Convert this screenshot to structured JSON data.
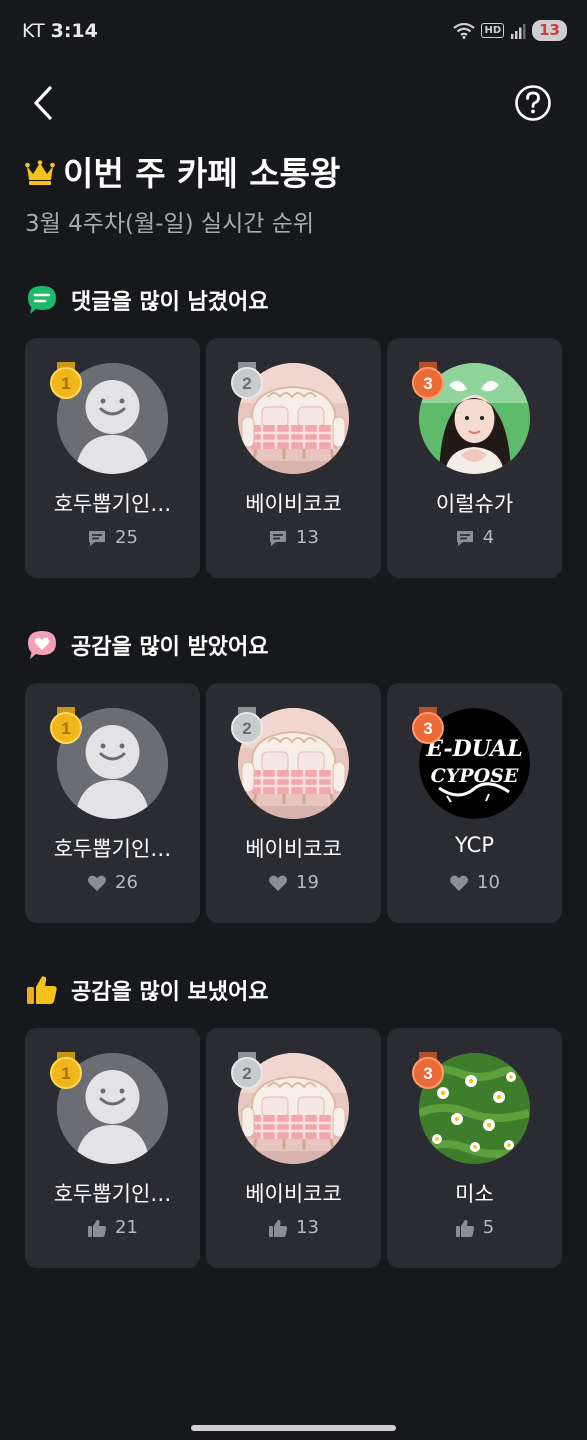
{
  "status_bar": {
    "carrier": "KT",
    "time": "3:14",
    "hd": "HD",
    "battery": "13"
  },
  "header": {
    "title": "이번 주 카페 소통왕",
    "subtitle": "3월 4주차(월-일) 실시간 순위"
  },
  "icons": {
    "back": "chevron-left-icon",
    "help": "question-circle-icon",
    "crown": "crown-icon",
    "comment_section": "comment-bubble-icon",
    "like_received_section": "heart-bubble-icon",
    "like_sent_section": "thumbs-up-icon"
  },
  "colors": {
    "background": "#17181b",
    "card": "#2b2c31",
    "gold": "#f1b61c",
    "silver": "#bdbec3",
    "bronze": "#ec6a38",
    "comment_green": "#20b86a",
    "heart_pink": "#f4a0b8",
    "crown_yellow": "#f5c21c"
  },
  "sections": [
    {
      "title": "댓글을 많이 남겼어요",
      "entries": [
        {
          "rank": "1",
          "name": "호두뽑기인…",
          "count": "25"
        },
        {
          "rank": "2",
          "name": "베이비코코",
          "count": "13"
        },
        {
          "rank": "3",
          "name": "이럴슈가",
          "count": "4"
        }
      ]
    },
    {
      "title": "공감을 많이 받았어요",
      "entries": [
        {
          "rank": "1",
          "name": "호두뽑기인…",
          "count": "26"
        },
        {
          "rank": "2",
          "name": "베이비코코",
          "count": "19"
        },
        {
          "rank": "3",
          "name": "YCP",
          "count": "10"
        }
      ]
    },
    {
      "title": "공감을 많이 보냈어요",
      "entries": [
        {
          "rank": "1",
          "name": "호두뽑기인…",
          "count": "21"
        },
        {
          "rank": "2",
          "name": "베이비코코",
          "count": "13"
        },
        {
          "rank": "3",
          "name": "미소",
          "count": "5"
        }
      ]
    }
  ]
}
